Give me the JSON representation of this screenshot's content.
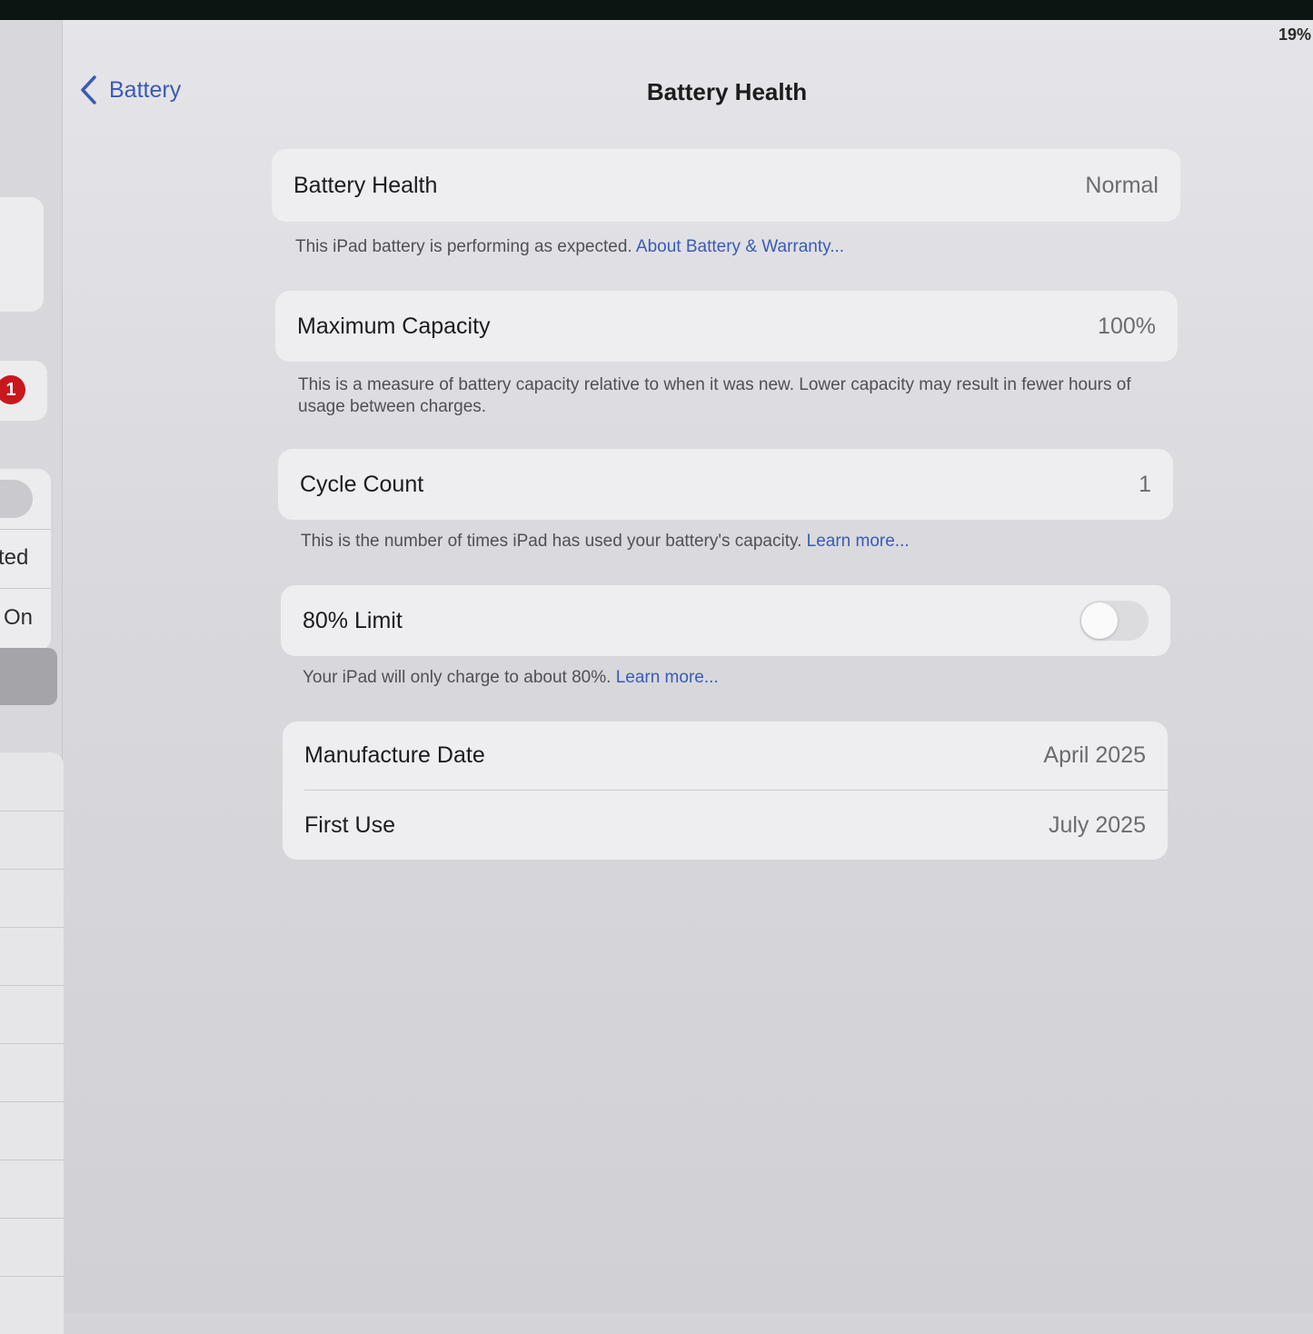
{
  "status_bar": {
    "battery_percent": "19%"
  },
  "sidebar": {
    "badge_count": "1",
    "item_text_1": "ted",
    "item_text_2": "On"
  },
  "nav": {
    "back_label": "Battery",
    "title": "Battery Health"
  },
  "battery_health": {
    "label": "Battery Health",
    "value": "Normal",
    "footer_text": "This iPad battery is performing as expected. ",
    "footer_link": "About Battery & Warranty..."
  },
  "maximum_capacity": {
    "label": "Maximum Capacity",
    "value": "100%",
    "footer_text": "This is a measure of battery capacity relative to when it was new. Lower capacity may result in fewer hours of usage between charges."
  },
  "cycle_count": {
    "label": "Cycle Count",
    "value": "1",
    "footer_text": "This is the number of times iPad has used your battery's capacity. ",
    "footer_link": "Learn more..."
  },
  "limit_80": {
    "label": "80% Limit",
    "enabled": false,
    "footer_text": "Your iPad will only charge to about 80%. ",
    "footer_link": "Learn more..."
  },
  "dates": {
    "manufacture_label": "Manufacture Date",
    "manufacture_value": "April 2025",
    "first_use_label": "First Use",
    "first_use_value": "July 2025"
  },
  "colors": {
    "accent": "#3a5ab5",
    "badge": "#c8171d"
  }
}
